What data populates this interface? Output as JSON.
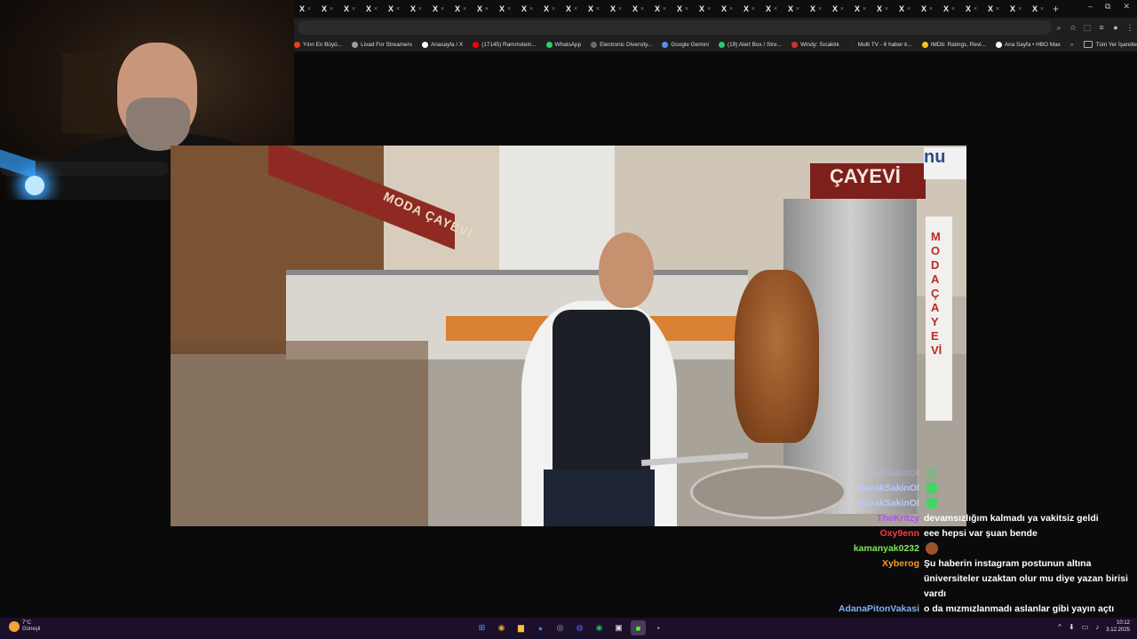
{
  "browser": {
    "tabs": [
      "X",
      "X",
      "X",
      "X",
      "X",
      "X",
      "X",
      "X",
      "X",
      "X",
      "X",
      "X",
      "X",
      "X",
      "X",
      "X",
      "X",
      "X",
      "X",
      "X",
      "X",
      "X",
      "X",
      "X",
      "X",
      "X",
      "X",
      "X",
      "X",
      "X",
      "X",
      "X",
      "X",
      "X"
    ],
    "new_tab_label": "+",
    "window_controls": [
      "–",
      "⧉",
      "✕"
    ],
    "bookmarks": [
      {
        "label": "Yılın En Büyü...",
        "color": "#e6411f"
      },
      {
        "label": "Livad For Streamers",
        "color": "#9aa0a6"
      },
      {
        "label": "Anasayfa / X",
        "color": "#ffffff"
      },
      {
        "label": "(17145) Rammstein...",
        "color": "#ff0000"
      },
      {
        "label": "WhatsApp",
        "color": "#25d366"
      },
      {
        "label": "Electronic Diversity...",
        "color": "#6a6a6a"
      },
      {
        "label": "Google Gemini",
        "color": "#5a8dee"
      },
      {
        "label": "(19) Alert Box / Stre...",
        "color": "#31c27c"
      },
      {
        "label": "Windy: Sıcaklık",
        "color": "#d0312d"
      },
      {
        "label": "Multi TV - 6 haber k...",
        "color": "#222222"
      },
      {
        "label": "IMDb: Ratings, Revi...",
        "color": "#f5c518"
      },
      {
        "label": "Ana Sayfa • HBO Max",
        "color": "#ffffff"
      }
    ],
    "bookmarks_more": "»",
    "all_bookmarks_label": "Tüm Yer İşaretleri"
  },
  "scene": {
    "shop_sign_text": "MODA ÇAYEVİ",
    "cayevi_text": "ÇAYEVİ",
    "nu_text": "nu",
    "vertical_sign_text": "MODA ÇAYEVİ"
  },
  "chat": [
    {
      "user": "BurakSakinOl",
      "color": "#b9c7ff",
      "msg": "",
      "emote": "#4ad26a",
      "ghost": true
    },
    {
      "user": "BurakSakinOl",
      "color": "#b9c7ff",
      "msg": "",
      "emote": "#4ad26a",
      "ghost": false
    },
    {
      "user": "BurakSakinOl",
      "color": "#b9c7ff",
      "msg": "",
      "emote": "#4ad26a",
      "ghost": false
    },
    {
      "user": "TheKritzy",
      "color": "#b14cff",
      "msg": "devamsızlığım kalmadı ya vakitsiz geldi",
      "emote": null,
      "ghost": false
    },
    {
      "user": "Oxy9enn",
      "color": "#ff3b3b",
      "msg": "eee hepsi var şuan bende",
      "emote": null,
      "ghost": false
    },
    {
      "user": "kamanyak0232",
      "color": "#7de85a",
      "msg": "",
      "emote": "#a0522d",
      "ghost": false
    },
    {
      "user": "Xyberog",
      "color": "#ff9a1f",
      "msg": "Şu haberin instagram postunun altına üniversiteler uzaktan olur mu diye yazan birisi vardı",
      "emote": null,
      "ghost": false
    },
    {
      "user": "AdanaPitonVakasi",
      "color": "#7fb0ff",
      "msg": "o da mızmızlanmadı aslanlar gibi yayın açtı burak abim",
      "emote": null,
      "ghost": false
    }
  ],
  "taskbar": {
    "weather_temp": "7°C",
    "weather_desc": "Güneşli",
    "apps": [
      {
        "name": "windows-start",
        "glyph": "⊞",
        "color": "#4aa3ff"
      },
      {
        "name": "chrome",
        "glyph": "◉",
        "color": "#e8b02b"
      },
      {
        "name": "file-explorer",
        "glyph": "▆",
        "color": "#f2c23a"
      },
      {
        "name": "app-blue",
        "glyph": "●",
        "color": "#3a7bd5"
      },
      {
        "name": "steam",
        "glyph": "◎",
        "color": "#8fb8d8"
      },
      {
        "name": "discord",
        "glyph": "◍",
        "color": "#5865f2"
      },
      {
        "name": "spotify",
        "glyph": "◉",
        "color": "#1db954"
      },
      {
        "name": "epic-games",
        "glyph": "▣",
        "color": "#dddddd"
      },
      {
        "name": "kick",
        "glyph": "■",
        "color": "#53fc18"
      },
      {
        "name": "obs",
        "glyph": "◔",
        "color": "#dddddd"
      }
    ],
    "tray_icons": [
      "^",
      "⬇",
      "▭",
      "♪"
    ],
    "clock_time": "10:12",
    "clock_date": "3.12.2025"
  }
}
